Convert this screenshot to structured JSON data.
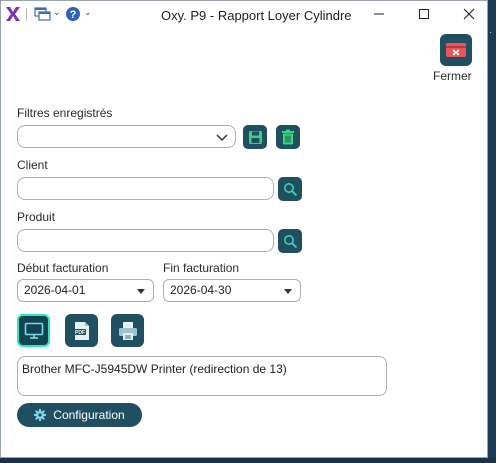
{
  "window": {
    "title": "Oxy. P9 - Rapport Loyer Cylindre"
  },
  "toolbar": {
    "close_label": "Fermer"
  },
  "filters": {
    "saved_label": "Filtres enregistrés",
    "saved_value": ""
  },
  "client": {
    "label": "Client",
    "value": ""
  },
  "product": {
    "label": "Produit",
    "value": ""
  },
  "dates": {
    "start_label": "Début facturation",
    "start_value": "2026-04-01",
    "end_label": "Fin facturation",
    "end_value": "2026-04-30"
  },
  "printer": {
    "selected": "Brother MFC-J5945DW Printer (redirection de 13)"
  },
  "config": {
    "label": "Configuration"
  },
  "colors": {
    "accent": "#1f4f60",
    "active_outline": "#2ee6c0",
    "logo": "#7b2fbf"
  },
  "icons": {
    "logo": "x-logo-icon",
    "windows": "windows-icon",
    "help": "help-icon",
    "close_report": "close-report-icon",
    "save": "floppy-icon",
    "delete": "trash-icon",
    "search": "search-icon",
    "screen": "monitor-icon",
    "pdf": "pdf-icon",
    "print": "printer-icon",
    "gear": "gear-icon"
  }
}
